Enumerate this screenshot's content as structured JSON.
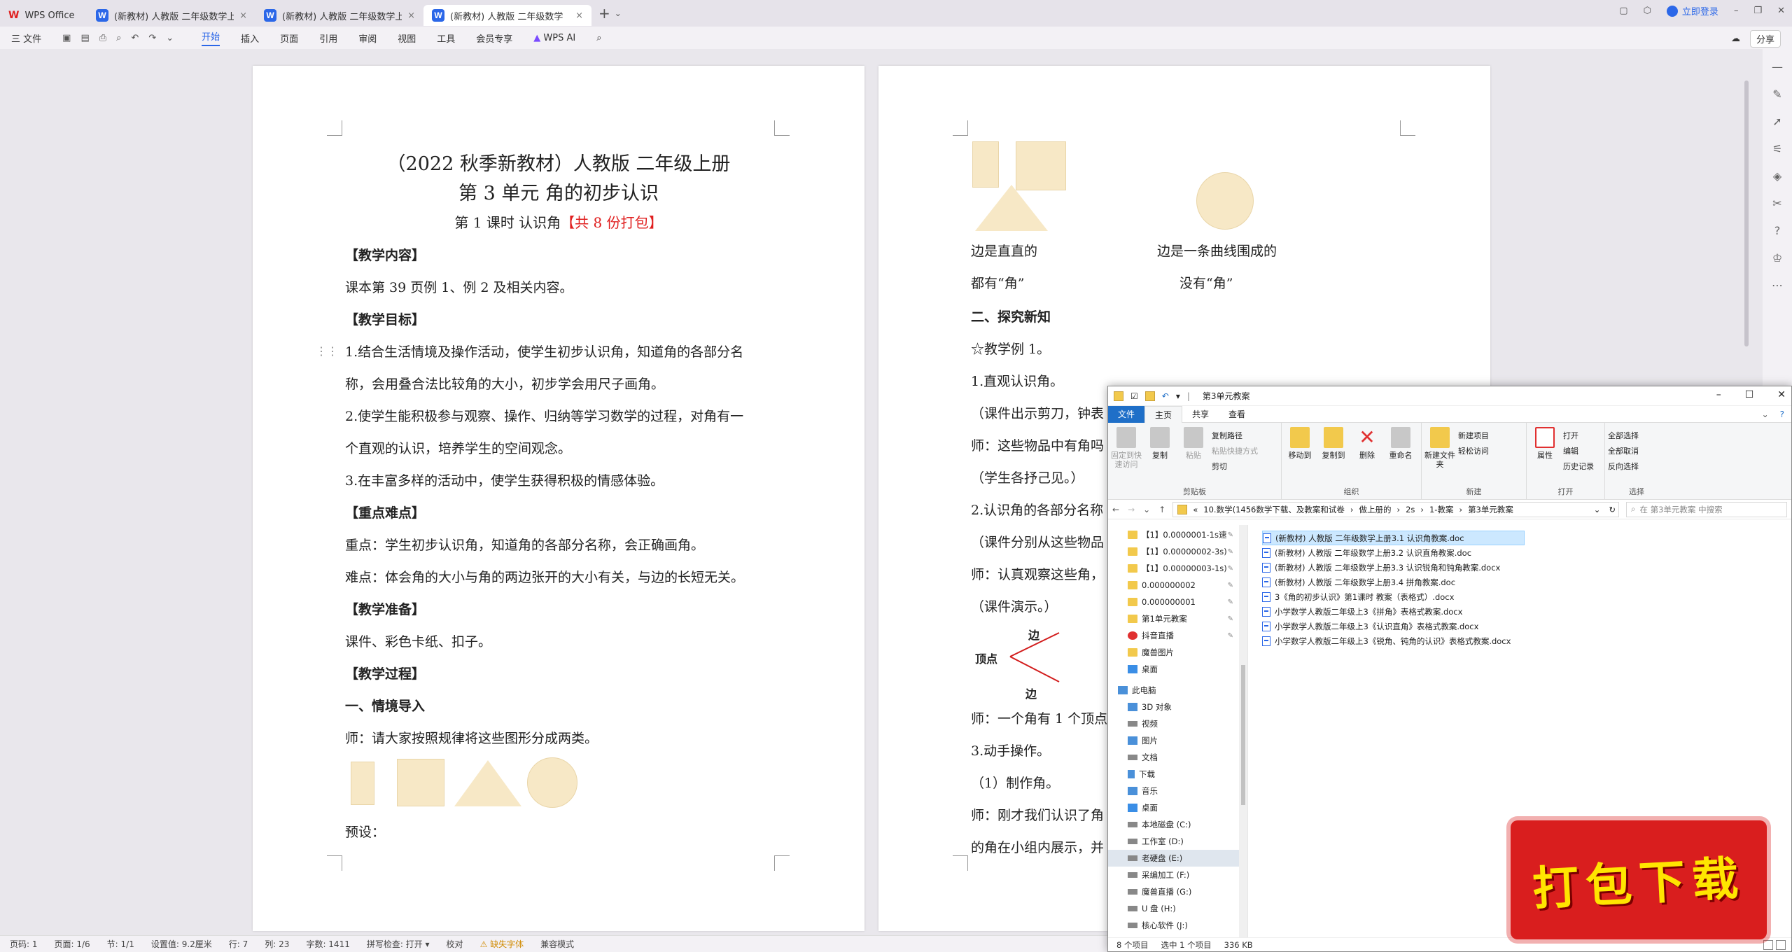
{
  "tabs": {
    "home": "WPS Office",
    "doc1": "(新教材) 人教版 二年级数学上册",
    "doc2": "(新教材) 人教版 二年级数学上册",
    "doc3": "(新教材) 人教版 二年级数学"
  },
  "titlebar": {
    "login": "立即登录"
  },
  "menu": {
    "file": "三 文件",
    "items": [
      "开始",
      "插入",
      "页面",
      "引用",
      "审阅",
      "视图",
      "工具",
      "会员专享"
    ],
    "ai": "WPS AI",
    "share": "分享"
  },
  "page1": {
    "title1": "（2022 秋季新教材）人教版  二年级上册",
    "title2": "第 3 单元   角的初步认识",
    "lesson": "第 1 课时      认识角",
    "pack": "【共 8 份打包】",
    "h_content": "【教学内容】",
    "content": "课本第 39 页例 1、例 2 及相关内容。",
    "h_goal": "【教学目标】",
    "goal1a": "1.结合生活情境及操作活动，使学生初步认识角，知道角的各部分名",
    "goal1b": "称，会用叠合法比较角的大小，初步学会用尺子画角。",
    "goal2a": "2.使学生能积极参与观察、操作、归纳等学习数学的过程，对角有一",
    "goal2b": "个直观的认识，培养学生的空间观念。",
    "goal3": "3.在丰富多样的活动中，使学生获得积极的情感体验。",
    "h_key": "【重点难点】",
    "key": "重点：学生初步认识角，知道角的各部分名称，会正确画角。",
    "diff": "难点：体会角的大小与角的两边张开的大小有关，与边的长短无关。",
    "h_prep": "【教学准备】",
    "prep": "课件、彩色卡纸、扣子。",
    "h_proc": "【教学过程】",
    "sec1": "一、情境导入",
    "teacher1": "师：请大家按照规律将这些图形分成两类。",
    "preset": "预设："
  },
  "page2": {
    "straight": "边是直直的",
    "curve": "边是一条曲线围成的",
    "hasangle": "都有“角”",
    "noangle": "没有“角”",
    "sec2": "二、探究新知",
    "ex1": "☆教学例 1。",
    "s1": "1.直观认识角。",
    "l1": "（课件出示剪刀，钟表",
    "l2": "师：这些物品中有角吗",
    "l3": "（学生各抒己见。）",
    "s2": "2.认识角的各部分名称",
    "l4": "（课件分别从这些物品",
    "l5": "师：认真观察这些角，",
    "l6": "（课件演示。）",
    "vertex": "顶点",
    "edge1": "边",
    "edge2": "边",
    "l7": "师：一个角有 1 个顶点",
    "s3": "3.动手操作。",
    "l8": "（1）制作角。",
    "l9": "师：刚才我们认识了角",
    "l10": "的角在小组内展示，并"
  },
  "explorer": {
    "title": "第3单元教案",
    "tabs": [
      "文件",
      "主页",
      "共享",
      "查看"
    ],
    "clipboard": {
      "pin": "固定到快速访问",
      "copy": "复制",
      "paste": "粘贴",
      "copypath": "复制路径",
      "pasteshortcut": "粘贴快捷方式",
      "cut": "剪切",
      "label": "剪贴板"
    },
    "organize": {
      "moveto": "移动到",
      "copyto": "复制到",
      "delete": "删除",
      "rename": "重命名",
      "label": "组织"
    },
    "new": {
      "newfolder": "新建文件夹",
      "newitem": "新建项目",
      "easyaccess": "轻松访问",
      "label": "新建"
    },
    "open": {
      "props": "属性",
      "open": "打开",
      "edit": "编辑",
      "history": "历史记录",
      "label": "打开"
    },
    "select": {
      "all": "全部选择",
      "none": "全部取消",
      "invert": "反向选择",
      "label": "选择"
    },
    "address": [
      "«",
      "10.数学(1456数学下载、及教案和试卷",
      "做上册的",
      "2s",
      "1-教案",
      "第3单元教案"
    ],
    "search_placeholder": "在 第3单元教案 中搜索",
    "nav": [
      "【1】0.0000001-1s速",
      "【1】0.00000002-3s)",
      "【1】0.00000003-1s)",
      "0.000000002",
      "0.000000001",
      "第1单元教案",
      "抖音直播",
      "魔兽图片",
      "桌面",
      "此电脑",
      "3D 对象",
      "视频",
      "图片",
      "文档",
      "下载",
      "音乐",
      "桌面",
      "本地磁盘 (C:)",
      "工作室 (D:)",
      "老硬盘 (E:)",
      "采编加工 (F:)",
      "魔兽直播 (G:)",
      "U 盘 (H:)",
      "核心软件 (J:)"
    ],
    "files": [
      "(新教材) 人教版 二年级数学上册3.1  认识角教案.doc",
      "(新教材) 人教版 二年级数学上册3.2  认识直角教案.doc",
      "(新教材) 人教版 二年级数学上册3.3  认识锐角和钝角教案.docx",
      "(新教材) 人教版 二年级数学上册3.4  拼角教案.doc",
      "3《角的初步认识》第1课时 教案（表格式）.docx",
      "小学数学人教版二年级上3《拼角》表格式教案.docx",
      "小学数学人教版二年级上3《认识直角》表格式教案.docx",
      "小学数学人教版二年级上3《锐角、钝角的认识》表格式教案.docx"
    ],
    "status": {
      "count": "8 个项目",
      "selected": "选中 1 个项目",
      "size": "336 KB"
    }
  },
  "statusbar": {
    "page": "页码: 1",
    "pages": "页面: 1/6",
    "section": "节: 1/1",
    "setting": "设置值: 9.2厘米",
    "row": "行: 7",
    "col": "列: 23",
    "words": "字数: 1411",
    "spell": "拼写检查: 打开 ▾",
    "proof": "校对",
    "missing": "⚠ 缺失字体",
    "compat": "兼容模式"
  },
  "stamp": "打包下载",
  "colors": {
    "accent": "#2b67e8",
    "shape": "#f7e8c6",
    "red": "#e02020",
    "stamp": "#d91e1e",
    "stamp_text": "#ffe500"
  }
}
